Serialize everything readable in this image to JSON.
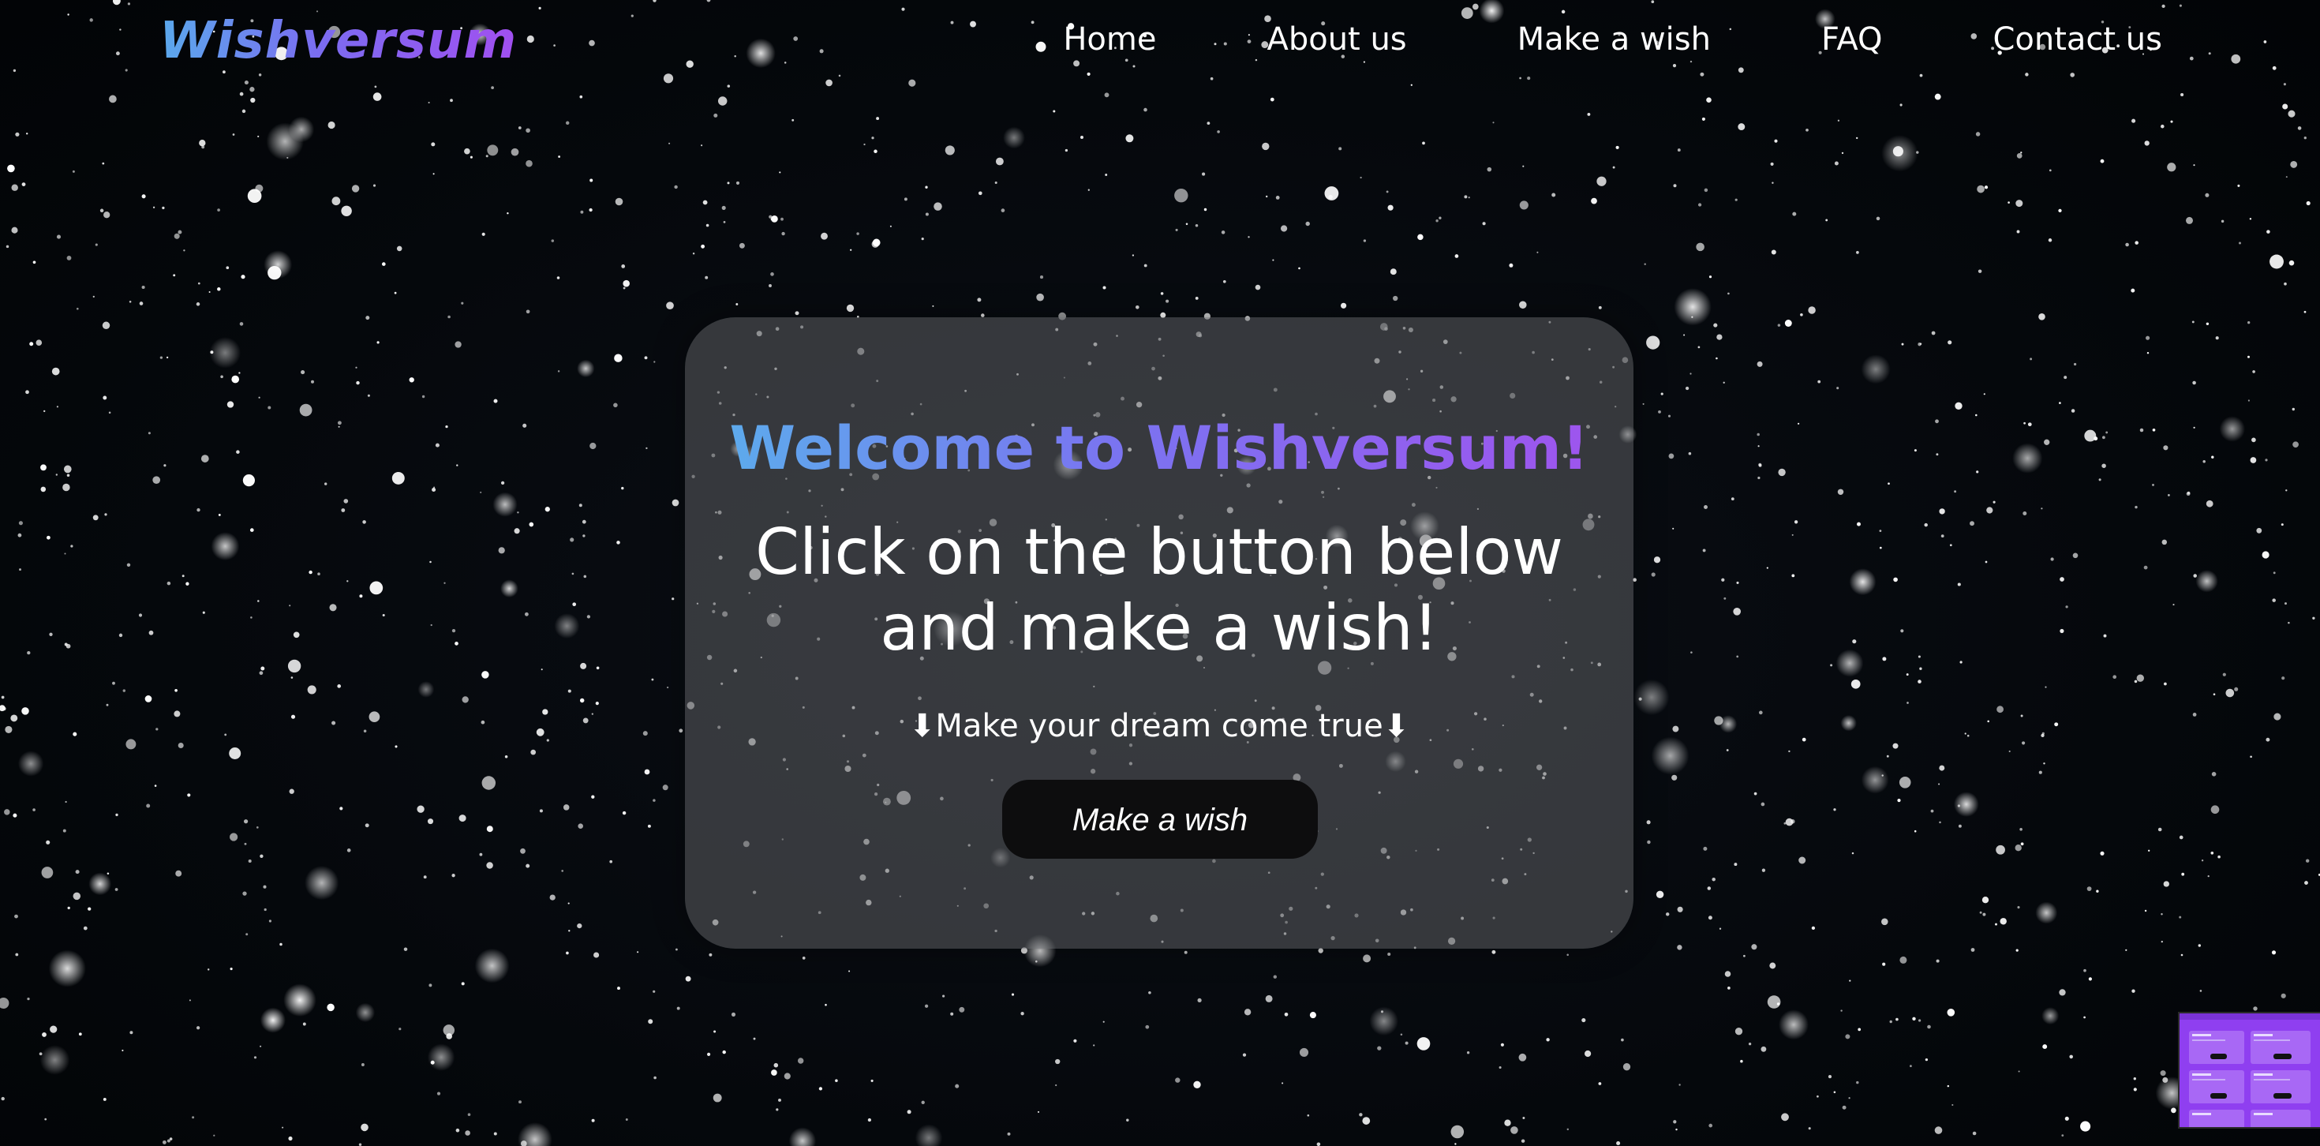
{
  "brand": {
    "logo_text": "Wishversum"
  },
  "nav": {
    "items": [
      {
        "label": "Home"
      },
      {
        "label": "About us"
      },
      {
        "label": "Make a wish"
      },
      {
        "label": "FAQ"
      },
      {
        "label": "Contact us"
      }
    ]
  },
  "hero": {
    "title": "Welcome to Wishversum!",
    "subtitle": "Click on the button below and make a wish!",
    "tagline": "⬇Make your dream come true⬇",
    "button_label": "Make a wish"
  },
  "colors": {
    "background": "#04070b",
    "gradient_start": "#5ab0ec",
    "gradient_mid": "#7a74f0",
    "gradient_end": "#a152ee",
    "card_overlay": "rgba(92, 94, 98, 0.55)",
    "button_bg": "#0d0d0e",
    "preview_thumb": "#8f3ff0"
  }
}
